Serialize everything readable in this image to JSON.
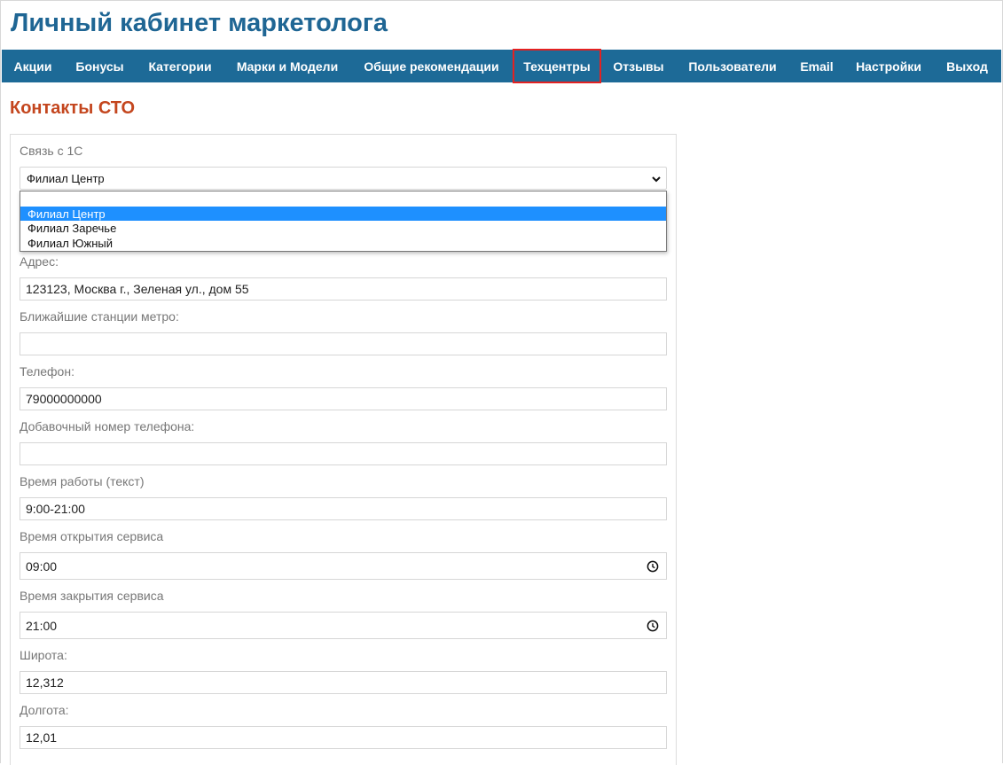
{
  "header": {
    "title": "Личный кабинет маркетолога"
  },
  "nav": {
    "items": [
      {
        "label": "Акции"
      },
      {
        "label": "Бонусы"
      },
      {
        "label": "Категории"
      },
      {
        "label": "Марки и Модели"
      },
      {
        "label": "Общие рекомендации"
      },
      {
        "label": "Техцентры"
      },
      {
        "label": "Отзывы"
      },
      {
        "label": "Пользователи"
      },
      {
        "label": "Email"
      },
      {
        "label": "Настройки"
      },
      {
        "label": "Выход"
      }
    ],
    "active": "Техцентры",
    "highlight_color": "#e32222",
    "background": "#1d6a97"
  },
  "page": {
    "title": "Контакты СТО"
  },
  "form": {
    "link_1c": {
      "label": "Связь с 1С",
      "selected": "Филиал Центр",
      "options": [
        "Филиал Центр",
        "Филиал Заречье",
        "Филиал Южный"
      ]
    },
    "address": {
      "label": "Адрес:",
      "value": "123123, Москва г., Зеленая ул., дом 55"
    },
    "metro": {
      "label": "Ближайшие станции метро:",
      "value": ""
    },
    "phone": {
      "label": "Телефон:",
      "value": "79000000000"
    },
    "phone_ext": {
      "label": "Добавочный номер телефона:",
      "value": ""
    },
    "work_time_text": {
      "label": "Время работы (текст)",
      "value": "9:00-21:00"
    },
    "open_time": {
      "label": "Время открытия сервиса",
      "value": "09:00",
      "icon": "clock-icon"
    },
    "close_time": {
      "label": "Время закрытия сервиса",
      "value": "21:00",
      "icon": "clock-icon"
    },
    "latitude": {
      "label": "Широта:",
      "value": "12,312"
    },
    "longitude": {
      "label": "Долгота:",
      "value": "12,01"
    }
  },
  "colors": {
    "title": "#1f6694",
    "section_title": "#c4461e",
    "dropdown_selected": "#1e90ff"
  }
}
